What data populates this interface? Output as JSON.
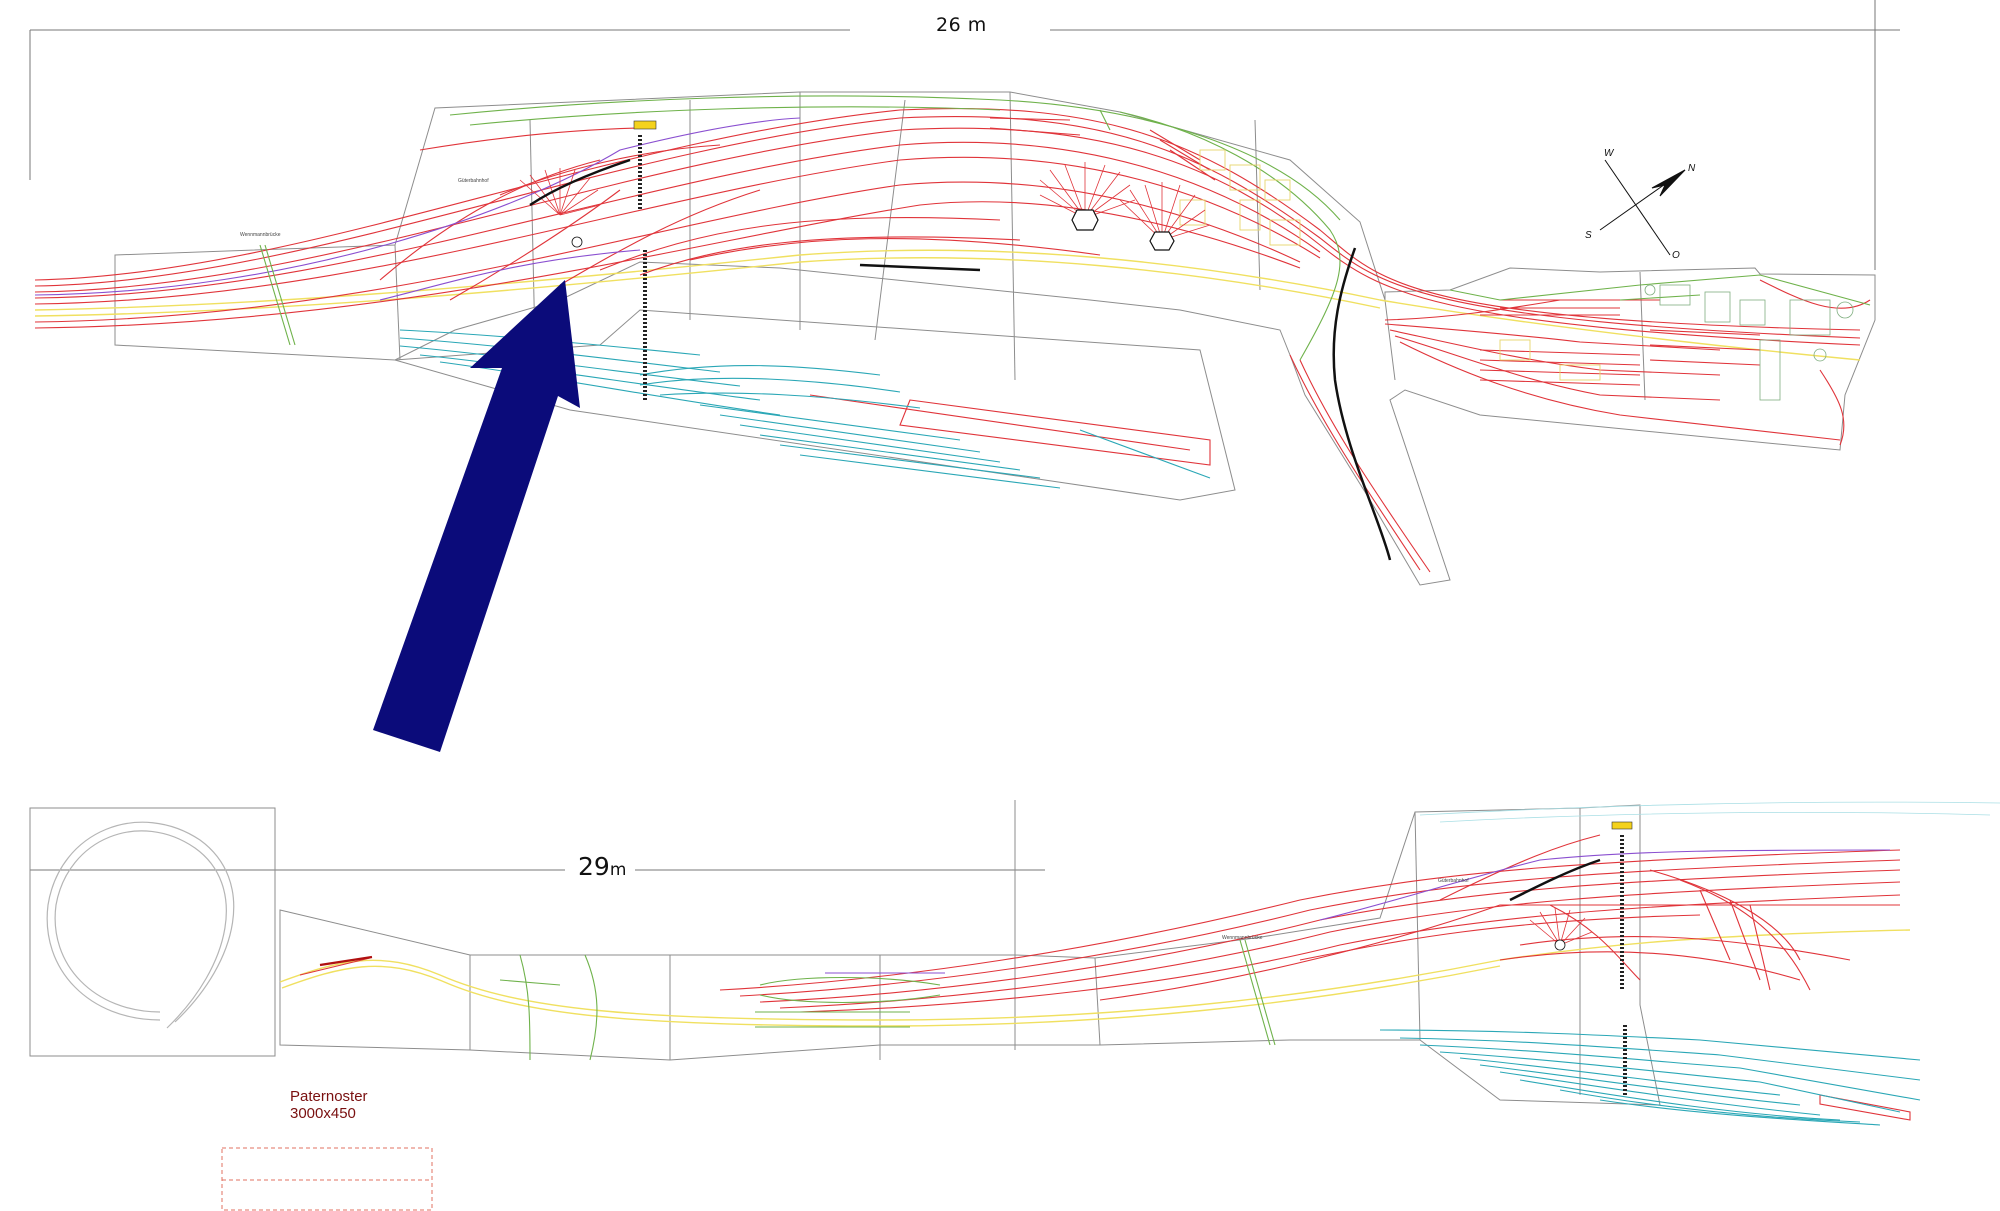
{
  "dimensions": {
    "top_length_value": "26",
    "top_length_unit": "m",
    "bottom_length_value": "29",
    "bottom_length_unit": "m"
  },
  "paternoster": {
    "title": "Paternoster",
    "size": "3000x450"
  },
  "compass": {
    "west": "W",
    "north": "N",
    "south": "S",
    "east": "O"
  },
  "station_labels": {
    "bridge_top": "Wennmannbrücke",
    "bridge_bottom": "Wennmannbrücke",
    "yard_top": "Güterbahnhof",
    "yard_bottom": "Güterbahnhof"
  },
  "colors": {
    "main_track": "#e0343a",
    "freight_track": "#2aa7b6",
    "through_track": "#f0e060",
    "branch_track": "#6fb24b",
    "special_track": "#8a4fd0",
    "outline": "#8a8a8a",
    "arrow": "#0b0b7a"
  }
}
